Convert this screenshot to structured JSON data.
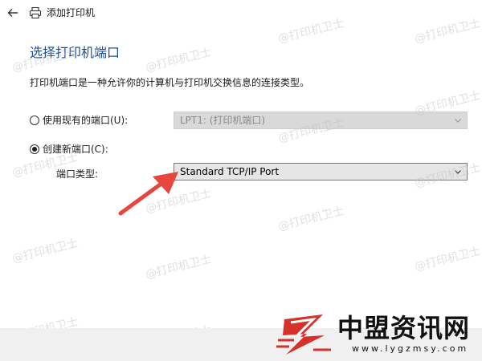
{
  "window": {
    "title": "添加打印机"
  },
  "page": {
    "heading": "选择打印机端口",
    "description": "打印机端口是一种允许你的计算机与打印机交换信息的连接类型。"
  },
  "options": {
    "existing_port": {
      "label": "使用现有的端口(U):",
      "value": "LPT1: (打印机端口)",
      "selected": false
    },
    "new_port": {
      "label": "创建新端口(C):",
      "selected": true
    }
  },
  "port_type": {
    "label": "端口类型:",
    "value": "Standard TCP/IP Port"
  },
  "watermark": {
    "text": "@打印机卫士"
  },
  "branding": {
    "name": "中盟资讯网",
    "url": "www.lygzmsy.com"
  },
  "colors": {
    "heading": "#1a4e9c",
    "arrow": "#e8463c",
    "logo_red": "#d6302b"
  },
  "icons": {
    "back": "arrow-left-icon",
    "printer": "printer-icon",
    "dropdown": "chevron-down-icon"
  }
}
